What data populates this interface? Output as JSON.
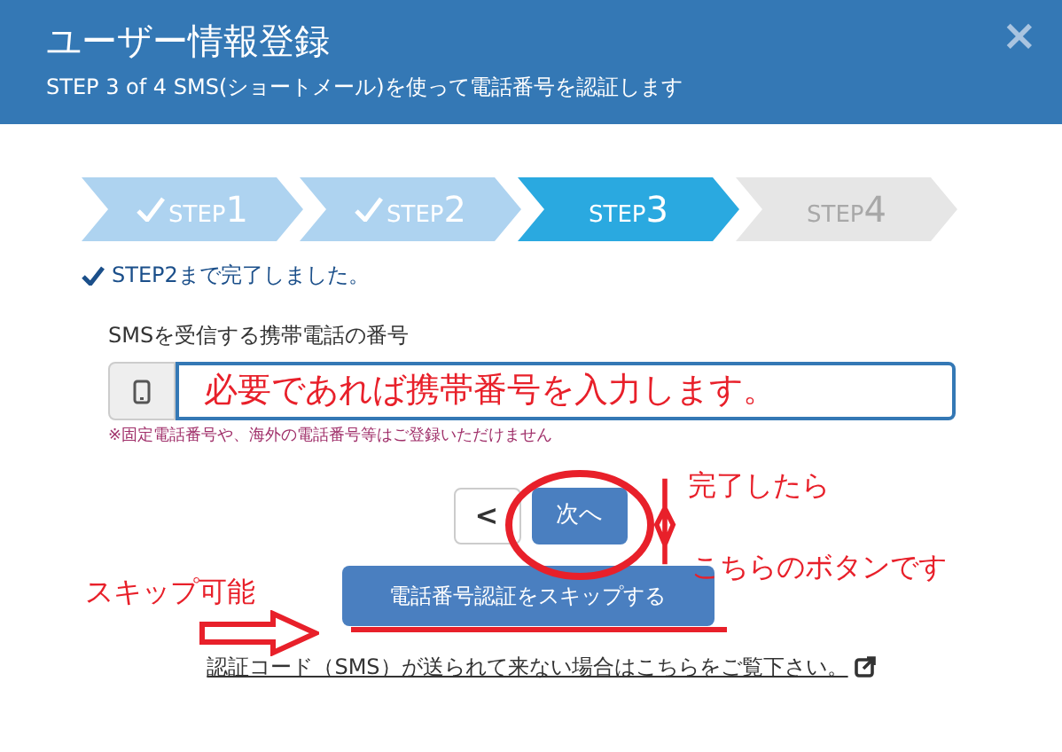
{
  "dialog": {
    "title": "ユーザー情報登録",
    "subtitle": "STEP 3 of 4 SMS(ショートメール)を使って電話番号を認証します",
    "close": "×"
  },
  "steps": [
    {
      "prefix": "STEP",
      "number": "1",
      "kind": "done"
    },
    {
      "prefix": "STEP",
      "number": "2",
      "kind": "done"
    },
    {
      "prefix": "STEP",
      "number": "3",
      "kind": "current"
    },
    {
      "prefix": "STEP",
      "number": "4",
      "kind": "pending"
    }
  ],
  "status": "STEP2まで完了しました。",
  "phone_field": {
    "label": "SMSを受信する携帯電話の番号",
    "value": "必要であれば携帯番号を入力します。",
    "note": "※固定電話番号や、海外の電話番号等はご登録いただけません"
  },
  "buttons": {
    "back": "<",
    "next": "次へ",
    "skip": "電話番号認証をスキップする"
  },
  "help_link": "認証コード（SMS）が送られて来ない場合はこちらをご覧下さい。",
  "annotations": [
    {
      "text": "完了したら"
    },
    {
      "text": "こちらのボタンです"
    },
    {
      "text": "スキップ可能"
    }
  ]
}
